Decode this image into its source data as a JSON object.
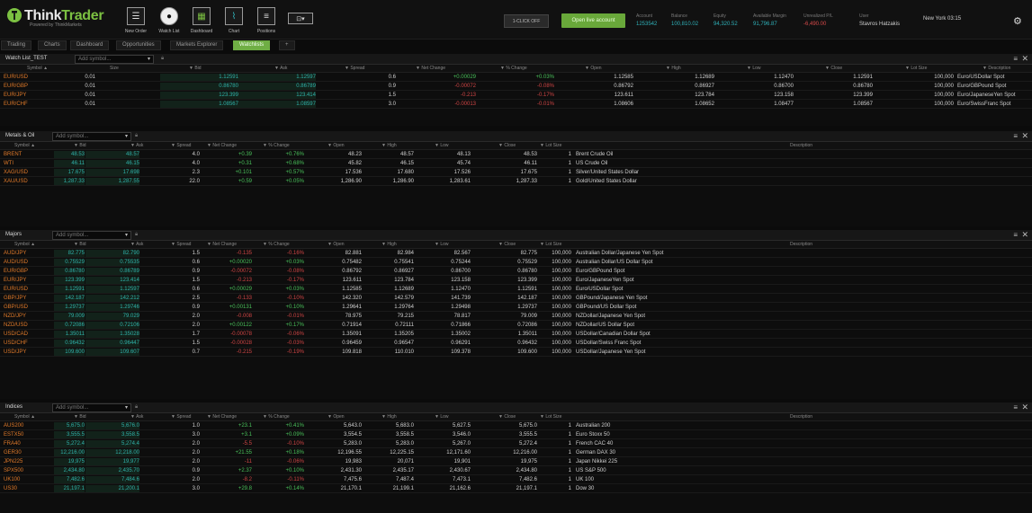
{
  "brand": {
    "think": "Think",
    "trader": "Trader",
    "sub": "Powered by ThinkMarkets"
  },
  "toolbar": [
    {
      "label": "New Order",
      "icon": "new-order-icon"
    },
    {
      "label": "Watch List",
      "icon": "eye-icon"
    },
    {
      "label": "Dashboard",
      "icon": "dashboard-icon"
    },
    {
      "label": "Chart",
      "icon": "chart-icon"
    },
    {
      "label": "Positions",
      "icon": "positions-icon"
    }
  ],
  "one_click": "1-CLICK OFF",
  "live_account": "Open live account",
  "stats": [
    {
      "label": "Account",
      "value": "1253542"
    },
    {
      "label": "Balance",
      "value": "100,810.02"
    },
    {
      "label": "Equity",
      "value": "94,320.52"
    },
    {
      "label": "Available Margin",
      "value": "91,796.87"
    },
    {
      "label": "Unrealized P/L",
      "value": "-6,490.00"
    },
    {
      "label": "User",
      "value": "Stavros Hatzakis"
    },
    {
      "label": "",
      "value": "New York  03:15"
    }
  ],
  "tabs": [
    "Trading",
    "Charts",
    "Dashboard",
    "Opportunities",
    "Markets Explorer",
    "Watchlists",
    "+"
  ],
  "add_symbol_placeholder": "Add symbol...",
  "watchlist": {
    "title": "Watch List_TEST",
    "columns": [
      "Symbol",
      "Size",
      "Bid",
      "Ask",
      "Spread",
      "Net Change",
      "% Change",
      "Open",
      "High",
      "Low",
      "Close",
      "Lot Size",
      "Description"
    ],
    "rows": [
      [
        "EUR/USD",
        "0.01",
        "1.12591",
        "1.12597",
        "0.6",
        "+0.00029",
        "+0.03%",
        "1.12585",
        "1.12689",
        "1.12470",
        "1.12591",
        "100,000",
        "Euro/USDollar Spot"
      ],
      [
        "EUR/GBP",
        "0.01",
        "0.86780",
        "0.86789",
        "0.9",
        "-0.00072",
        "-0.08%",
        "0.86792",
        "0.86927",
        "0.86700",
        "0.86780",
        "100,000",
        "Euro/GBPound Spot"
      ],
      [
        "EUR/JPY",
        "0.01",
        "123.399",
        "123.414",
        "1.5",
        "-0.213",
        "-0.17%",
        "123.611",
        "123.784",
        "123.158",
        "123.399",
        "100,000",
        "Euro/JapaneseYen Spot"
      ],
      [
        "EUR/CHF",
        "0.01",
        "1.08567",
        "1.08597",
        "3.0",
        "-0.00013",
        "-0.01%",
        "1.08606",
        "1.08652",
        "1.08477",
        "1.08567",
        "100,000",
        "Euro/SwissFranc Spot"
      ]
    ]
  },
  "metals": {
    "title": "Metals & Oil",
    "columns": [
      "Symbol",
      "Bid",
      "Ask",
      "Spread",
      "Net Change",
      "% Change",
      "Open",
      "High",
      "Low",
      "Close",
      "Lot Size",
      "Description"
    ],
    "rows": [
      [
        "BRENT",
        "48.53",
        "48.57",
        "4.0",
        "+0.39",
        "+0.76%",
        "48.23",
        "48.57",
        "48.13",
        "48.53",
        "1",
        "Brent Crude Oil"
      ],
      [
        "WTI",
        "46.11",
        "46.15",
        "4.0",
        "+0.31",
        "+0.68%",
        "45.82",
        "46.15",
        "45.74",
        "46.11",
        "1",
        "US Crude Oil"
      ],
      [
        "XAG/USD",
        "17.675",
        "17.698",
        "2.3",
        "+0.101",
        "+0.57%",
        "17.536",
        "17.680",
        "17.526",
        "17.675",
        "1",
        "Silver/United States Dollar"
      ],
      [
        "XAU/USD",
        "1,287.33",
        "1,287.55",
        "22.0",
        "+0.59",
        "+0.05%",
        "1,286.90",
        "1,286.90",
        "1,283.61",
        "1,287.33",
        "1",
        "Gold/United States Dollar"
      ]
    ]
  },
  "majors": {
    "title": "Majors",
    "columns": [
      "Symbol",
      "Bid",
      "Ask",
      "Spread",
      "Net Change",
      "% Change",
      "Open",
      "High",
      "Low",
      "Close",
      "Lot Size",
      "Description"
    ],
    "rows": [
      [
        "AUD/JPY",
        "82.775",
        "82.790",
        "1.5",
        "-0.135",
        "-0.16%",
        "82.881",
        "82.984",
        "82.567",
        "82.775",
        "100,000",
        "Australian Dollar/Japanese Yen Spot"
      ],
      [
        "AUD/USD",
        "0.75529",
        "0.75535",
        "0.6",
        "+0.00020",
        "+0.03%",
        "0.75482",
        "0.75541",
        "0.75244",
        "0.75529",
        "100,000",
        "Australian Dollar/US Dollar Spot"
      ],
      [
        "EUR/GBP",
        "0.86780",
        "0.86789",
        "0.9",
        "-0.00072",
        "-0.08%",
        "0.86792",
        "0.86927",
        "0.86700",
        "0.86780",
        "100,000",
        "Euro/GBPound Spot"
      ],
      [
        "EUR/JPY",
        "123.399",
        "123.414",
        "1.5",
        "-0.213",
        "-0.17%",
        "123.611",
        "123.784",
        "123.158",
        "123.399",
        "100,000",
        "Euro/JapaneseYen Spot"
      ],
      [
        "EUR/USD",
        "1.12591",
        "1.12597",
        "0.6",
        "+0.00029",
        "+0.03%",
        "1.12585",
        "1.12689",
        "1.12470",
        "1.12591",
        "100,000",
        "Euro/USDollar Spot"
      ],
      [
        "GBP/JPY",
        "142.187",
        "142.212",
        "2.5",
        "-0.133",
        "-0.10%",
        "142.320",
        "142.579",
        "141.739",
        "142.187",
        "100,000",
        "GBPound/Japanese Yen Spot"
      ],
      [
        "GBP/USD",
        "1.29737",
        "1.29746",
        "0.9",
        "+0.00131",
        "+0.10%",
        "1.29641",
        "1.29764",
        "1.29498",
        "1.29737",
        "100,000",
        "GBPound/US Dollar Spot"
      ],
      [
        "NZD/JPY",
        "79.009",
        "79.029",
        "2.0",
        "-0.008",
        "-0.01%",
        "78.975",
        "79.215",
        "78.817",
        "79.009",
        "100,000",
        "NZDollar/Japanese Yen Spot"
      ],
      [
        "NZD/USD",
        "0.72086",
        "0.72106",
        "2.0",
        "+0.00122",
        "+0.17%",
        "0.71914",
        "0.72111",
        "0.71866",
        "0.72086",
        "100,000",
        "NZDollar/US Dollar Spot"
      ],
      [
        "USD/CAD",
        "1.35011",
        "1.35028",
        "1.7",
        "-0.00078",
        "-0.06%",
        "1.35091",
        "1.35205",
        "1.35002",
        "1.35011",
        "100,000",
        "USDollar/Canadian Dollar Spot"
      ],
      [
        "USD/CHF",
        "0.96432",
        "0.96447",
        "1.5",
        "-0.00028",
        "-0.03%",
        "0.96459",
        "0.96547",
        "0.96291",
        "0.96432",
        "100,000",
        "USDollar/Swiss Franc Spot"
      ],
      [
        "USD/JPY",
        "109.600",
        "109.607",
        "0.7",
        "-0.215",
        "-0.19%",
        "109.818",
        "110.010",
        "109.378",
        "109.600",
        "100,000",
        "USDollar/Japanese Yen Spot"
      ]
    ]
  },
  "indices": {
    "title": "Indices",
    "columns": [
      "Symbol",
      "Bid",
      "Ask",
      "Spread",
      "Net Change",
      "% Change",
      "Open",
      "High",
      "Low",
      "Close",
      "Lot Size",
      "Description"
    ],
    "rows": [
      [
        "AUS200",
        "5,675.0",
        "5,676.0",
        "1.0",
        "+23.1",
        "+0.41%",
        "5,643.0",
        "5,683.0",
        "5,627.5",
        "5,675.0",
        "1",
        "Australian 200"
      ],
      [
        "ESTX50",
        "3,555.5",
        "3,558.5",
        "3.0",
        "+3.1",
        "+0.09%",
        "3,554.5",
        "3,558.5",
        "3,546.0",
        "3,555.5",
        "1",
        "Euro Stoxx 50"
      ],
      [
        "FRA40",
        "5,272.4",
        "5,274.4",
        "2.0",
        "-5.5",
        "-0.10%",
        "5,283.0",
        "5,283.0",
        "5,267.0",
        "5,272.4",
        "1",
        "French CAC 40"
      ],
      [
        "GER30",
        "12,216.00",
        "12,218.00",
        "2.0",
        "+21.55",
        "+0.18%",
        "12,196.55",
        "12,225.15",
        "12,171.60",
        "12,216.00",
        "1",
        "German DAX 30"
      ],
      [
        "JPN225",
        "19,975",
        "19,977",
        "2.0",
        "-11",
        "-0.06%",
        "19,983",
        "20,071",
        "19,901",
        "19,975",
        "1",
        "Japan Nikkei 225"
      ],
      [
        "SPX500",
        "2,434.80",
        "2,435.70",
        "0.9",
        "+2.37",
        "+0.10%",
        "2,431.30",
        "2,435.17",
        "2,430.67",
        "2,434.80",
        "1",
        "US S&P 500"
      ],
      [
        "UK100",
        "7,482.6",
        "7,484.6",
        "2.0",
        "-8.2",
        "-0.11%",
        "7,475.6",
        "7,487.4",
        "7,473.1",
        "7,482.6",
        "1",
        "UK 100"
      ],
      [
        "US30",
        "21,197.1",
        "21,200.1",
        "3.0",
        "+29.8",
        "+0.14%",
        "21,170.1",
        "21,199.1",
        "21,162.6",
        "21,197.1",
        "1",
        "Dow 30"
      ]
    ]
  },
  "colors": {
    "brand_green": "#7cc142",
    "bid_ask": "#2fb0a8",
    "up": "#49c05a",
    "down": "#d04545",
    "symbol": "#e07a2a"
  }
}
